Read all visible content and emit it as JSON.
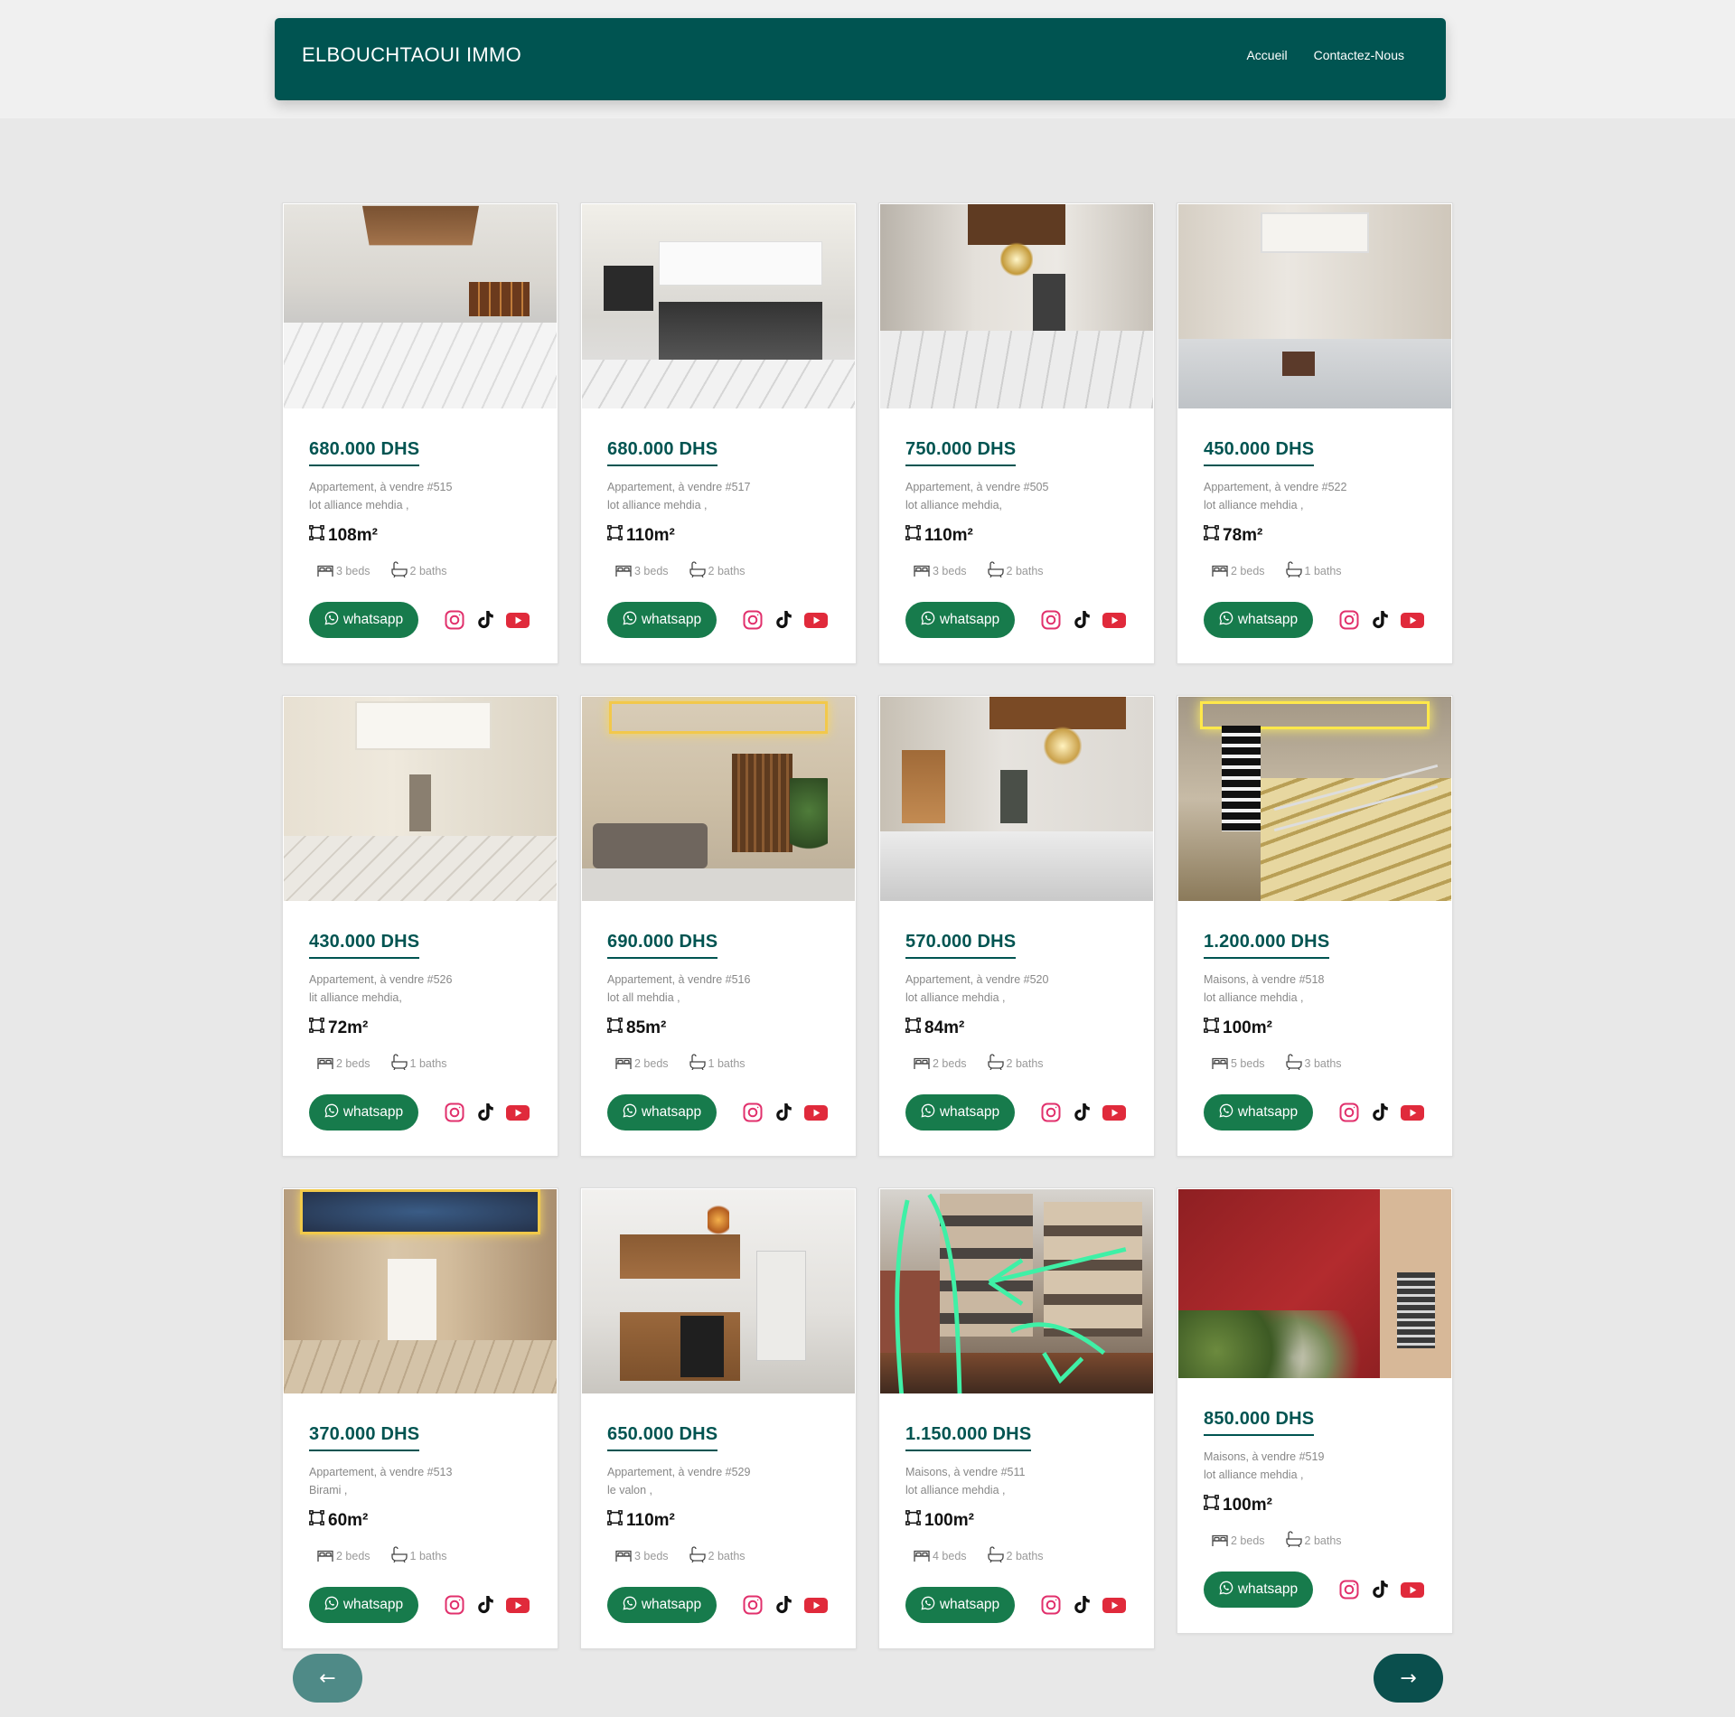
{
  "header": {
    "brand": "ELBOUCHTAOUI IMMO",
    "nav": [
      "Accueil",
      "Contactez-Nous"
    ]
  },
  "listings": [
    {
      "price": "680.000 DHS",
      "type": "Appartement, à vendre #515",
      "location": "lot alliance mehdia ,",
      "area": "108m²",
      "beds": "3 beds",
      "baths": "2 baths",
      "whatsapp": "whatsapp",
      "photo": "empty-room-wood-ceiling"
    },
    {
      "price": "680.000 DHS",
      "type": "Appartement, à vendre #517",
      "location": "lot alliance mehdia ,",
      "area": "110m²",
      "beds": "3 beds",
      "baths": "2 baths",
      "whatsapp": "whatsapp",
      "photo": "modern-kitchen"
    },
    {
      "price": "750.000 DHS",
      "type": "Appartement, à vendre #505",
      "location": "lot alliance mehdia,",
      "area": "110m²",
      "beds": "3 beds",
      "baths": "2 baths",
      "whatsapp": "whatsapp",
      "photo": "hallway-chandelier"
    },
    {
      "price": "450.000 DHS",
      "type": "Appartement, à vendre #522",
      "location": "lot alliance mehdia ,",
      "area": "78m²",
      "beds": "2 beds",
      "baths": "1 baths",
      "whatsapp": "whatsapp",
      "photo": "long-corridor"
    },
    {
      "price": "430.000 DHS",
      "type": "Appartement, à vendre #526",
      "location": "lit alliance mehdia,",
      "area": "72m²",
      "beds": "2 beds",
      "baths": "1 baths",
      "whatsapp": "whatsapp",
      "photo": "beige-corridor"
    },
    {
      "price": "690.000 DHS",
      "type": "Appartement, à vendre #516",
      "location": "lot all mehdia ,",
      "area": "85m²",
      "beds": "2 beds",
      "baths": "1 baths",
      "whatsapp": "whatsapp",
      "photo": "furnished-living-room"
    },
    {
      "price": "570.000 DHS",
      "type": "Appartement, à vendre #520",
      "location": "lot alliance mehdia ,",
      "area": "84m²",
      "beds": "2 beds",
      "baths": "2 baths",
      "whatsapp": "whatsapp",
      "photo": "living-room-chandelier"
    },
    {
      "price": "1.200.000 DHS",
      "type": "Maisons, à vendre #518",
      "location": "lot alliance mehdia ,",
      "area": "100m²",
      "beds": "5 beds",
      "baths": "3 baths",
      "whatsapp": "whatsapp",
      "photo": "staircase-yellow-lights"
    },
    {
      "price": "370.000 DHS",
      "type": "Appartement, à vendre #513",
      "location": "Birami ,",
      "area": "60m²",
      "beds": "2 beds",
      "baths": "1 baths",
      "whatsapp": "whatsapp",
      "photo": "corridor-led-ceiling"
    },
    {
      "price": "650.000 DHS",
      "type": "Appartement, à vendre #529",
      "location": "le valon ,",
      "area": "110m²",
      "beds": "3 beds",
      "baths": "2 baths",
      "whatsapp": "whatsapp",
      "photo": "wood-kitchen"
    },
    {
      "price": "1.150.000 DHS",
      "type": "Maisons, à vendre #511",
      "location": "lot alliance mehdia ,",
      "area": "100m²",
      "beds": "4 beds",
      "baths": "2 baths",
      "whatsapp": "whatsapp",
      "photo": "building-facade-annotated"
    },
    {
      "price": "850.000 DHS",
      "type": "Maisons, à vendre #519",
      "location": "lot alliance mehdia ,",
      "area": "100m²",
      "beds": "2 beds",
      "baths": "2 baths",
      "whatsapp": "whatsapp",
      "photo": "red-wall-exterior"
    }
  ],
  "pagination": {
    "prev": "←",
    "next": "→"
  },
  "colors": {
    "brand": "#005451",
    "whatsapp": "#177b4c",
    "instagram": "#e1306c",
    "youtube": "#e02a3b",
    "tiktok": "#111111"
  },
  "icons": {
    "area": "area-icon",
    "beds": "bed-icon",
    "baths": "bath-icon",
    "whatsapp": "whatsapp-icon",
    "socials": [
      "instagram-icon",
      "tiktok-icon",
      "youtube-icon"
    ]
  }
}
